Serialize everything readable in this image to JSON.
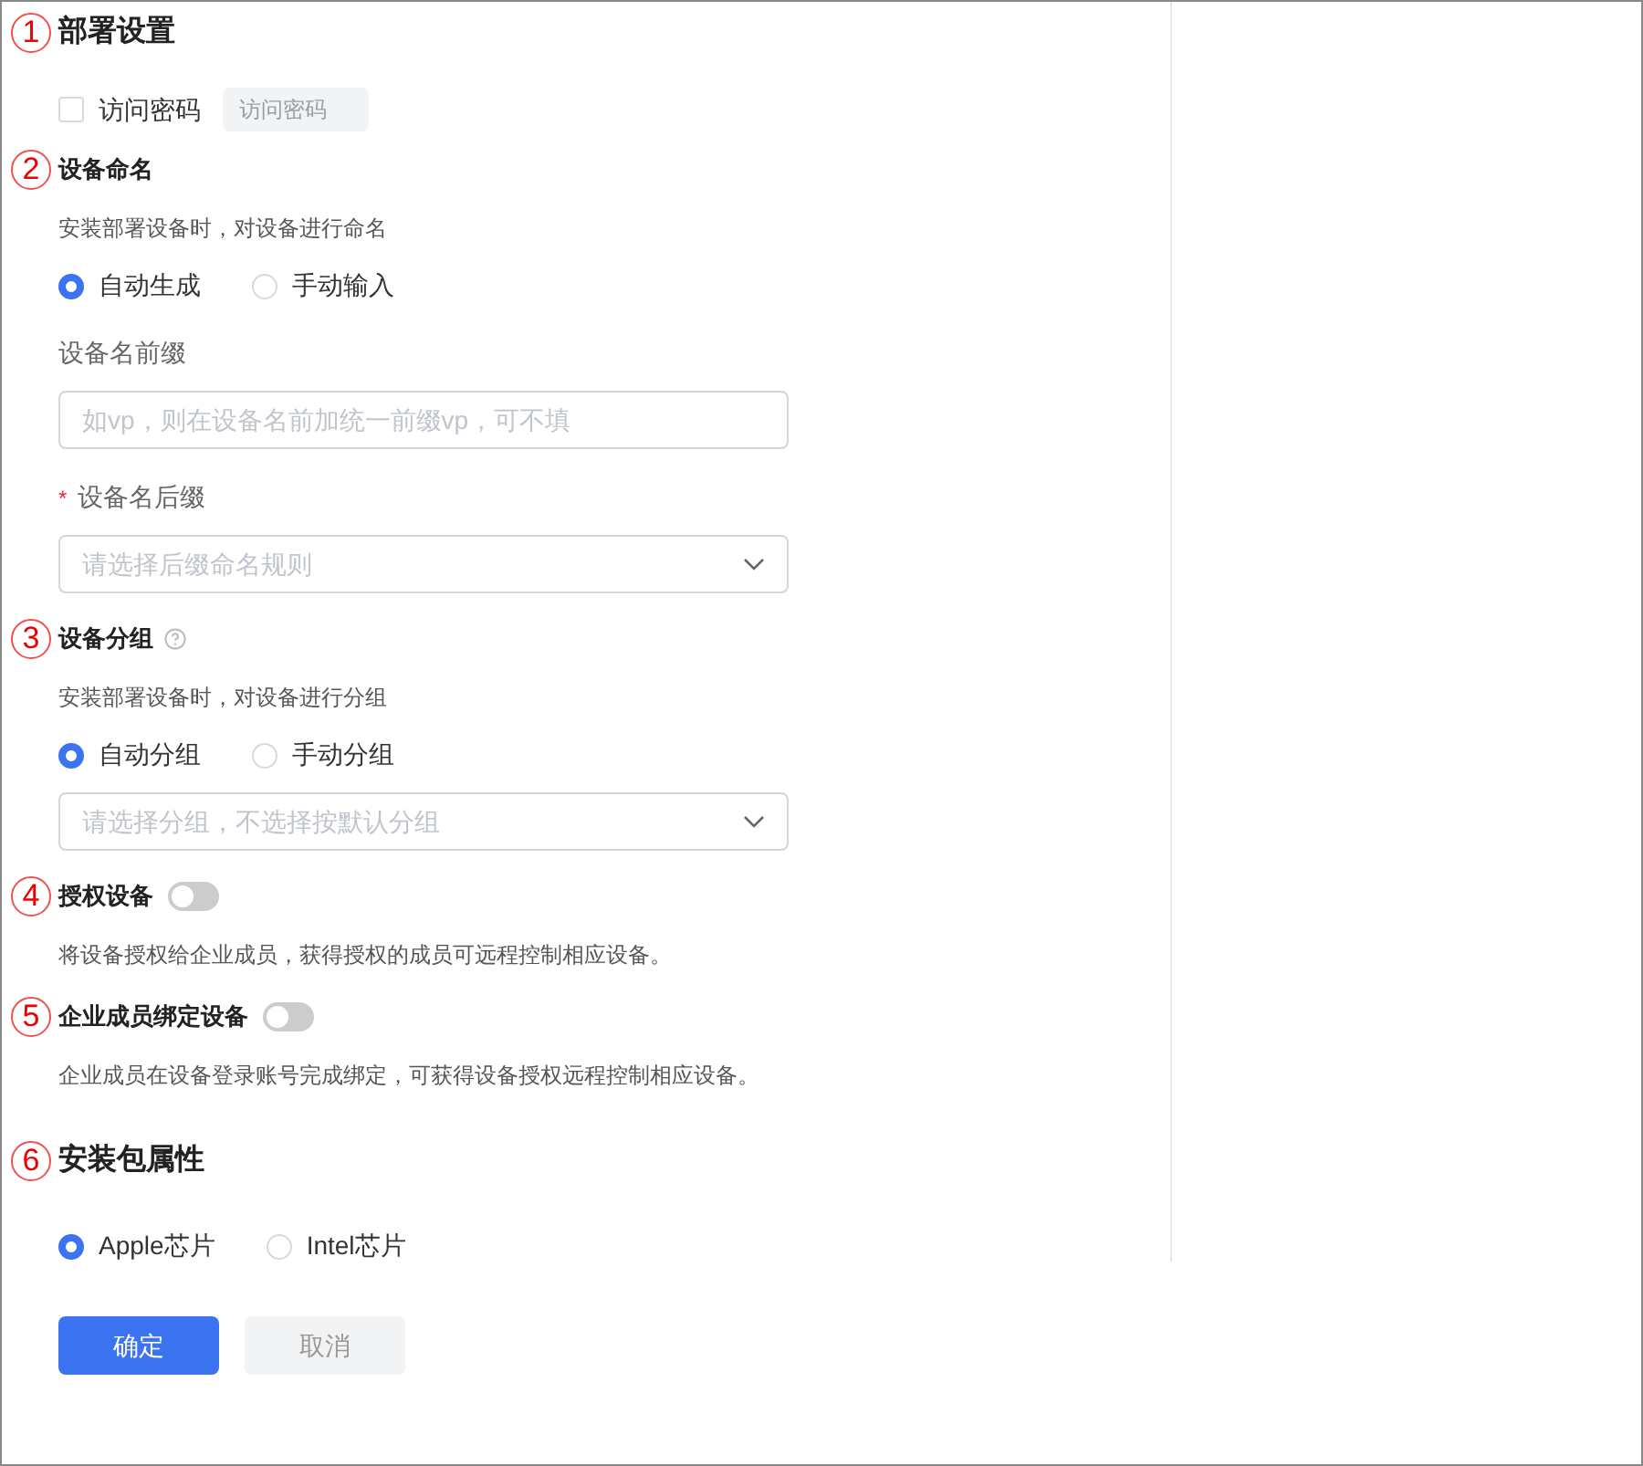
{
  "sections": [
    {
      "marker": "1",
      "title": "部署设置",
      "kind": "major",
      "items": [
        {
          "kind": "checkbox",
          "label": "访问密码",
          "checked": false,
          "placeholder": "访问密码"
        }
      ]
    },
    {
      "marker": "2",
      "title": "设备命名",
      "kind": "minor",
      "items": [
        {
          "kind": "description",
          "text": "安装部署设备时，对设备进行命名"
        },
        {
          "kind": "radios",
          "options": [
            {
              "label": "自动生成",
              "selected": true
            },
            {
              "label": "手动输入",
              "selected": false
            }
          ]
        },
        {
          "kind": "label",
          "text": "设备名前缀"
        },
        {
          "kind": "input",
          "placeholder": "如vp，则在设备名前加统一前缀vp，可不填"
        },
        {
          "kind": "label",
          "text": "设备名后缀",
          "required_mark": "*"
        },
        {
          "kind": "select",
          "placeholder": "请选择后缀命名规则"
        }
      ]
    },
    {
      "marker": "3",
      "title": "设备分组",
      "kind": "minor",
      "help": true,
      "items": [
        {
          "kind": "description",
          "text": "安装部署设备时，对设备进行分组"
        },
        {
          "kind": "radios",
          "options": [
            {
              "label": "自动分组",
              "selected": true
            },
            {
              "label": "手动分组",
              "selected": false
            }
          ]
        },
        {
          "kind": "select",
          "placeholder": "请选择分组，不选择按默认分组"
        }
      ]
    },
    {
      "marker": "4",
      "title": "授权设备",
      "kind": "minor",
      "toggle": {
        "on": false
      },
      "items": [
        {
          "kind": "description",
          "text": "将设备授权给企业成员，获得授权的成员可远程控制相应设备。"
        }
      ]
    },
    {
      "marker": "5",
      "title": "企业成员绑定设备",
      "kind": "minor",
      "toggle": {
        "on": false
      },
      "items": [
        {
          "kind": "description",
          "text": "企业成员在设备登录账号完成绑定，可获得设备授权远程控制相应设备。"
        }
      ]
    },
    {
      "marker": "6",
      "title": "安装包属性",
      "kind": "major",
      "items": [
        {
          "kind": "radios",
          "options": [
            {
              "label": "Apple芯片",
              "selected": true
            },
            {
              "label": "Intel芯片",
              "selected": false
            }
          ]
        }
      ]
    }
  ],
  "buttons": [
    {
      "label": "确定",
      "kind": "primary"
    },
    {
      "label": "取消",
      "kind": "secondary"
    }
  ]
}
